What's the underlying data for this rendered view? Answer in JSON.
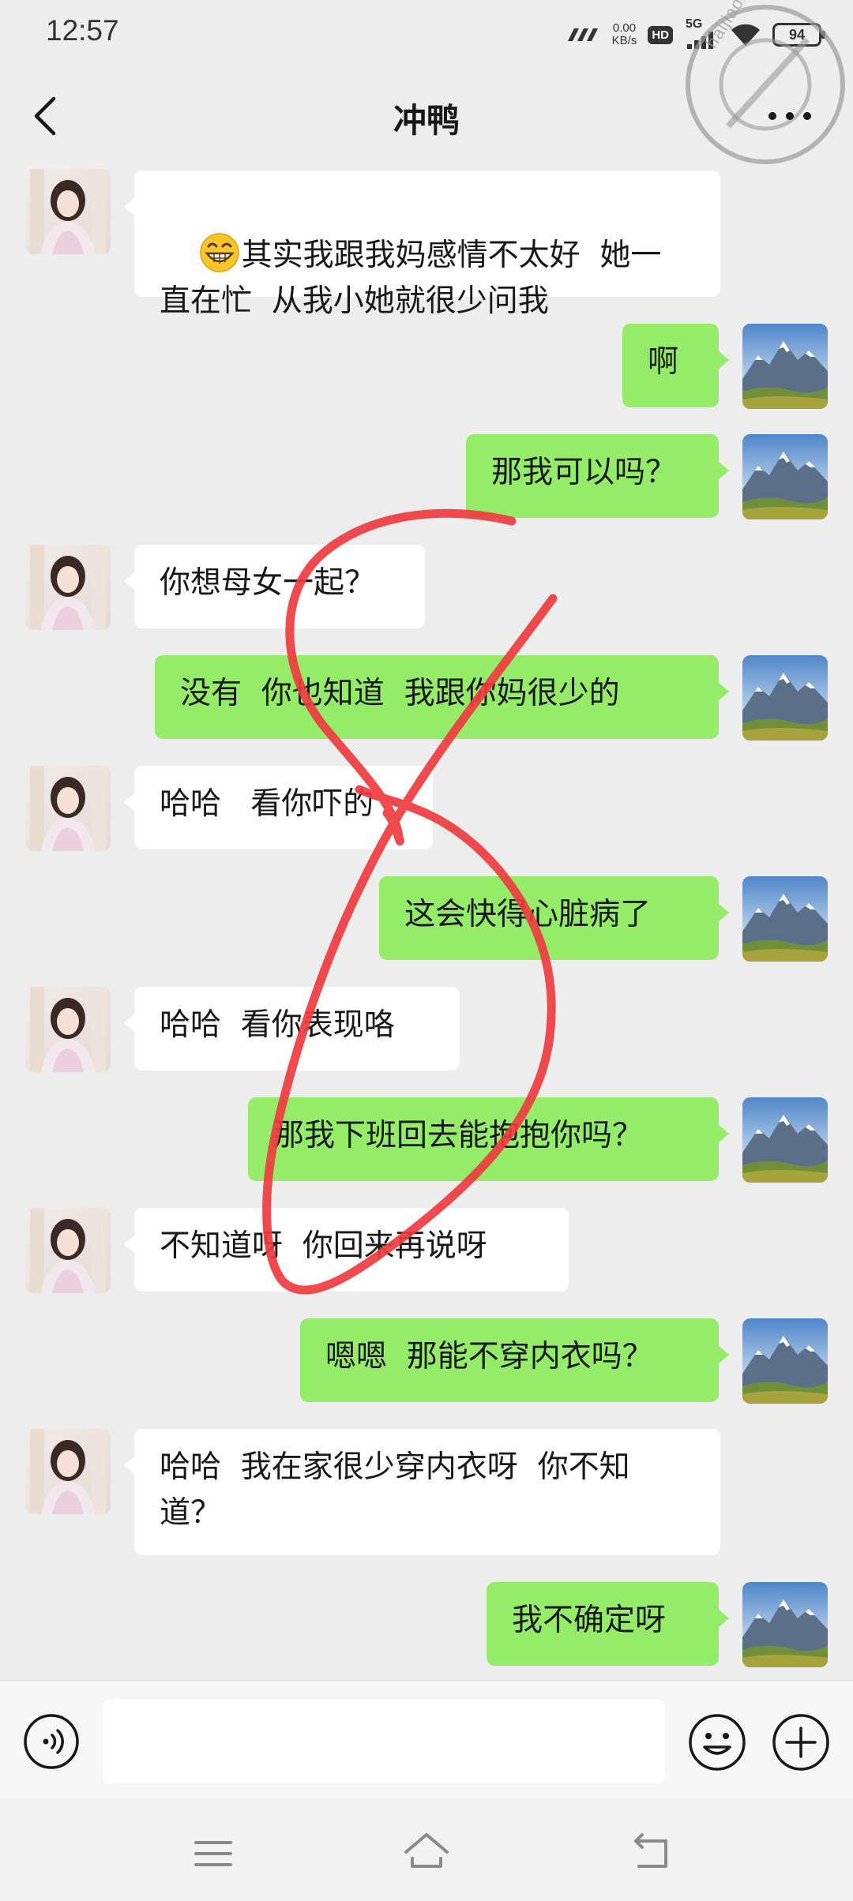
{
  "status_bar": {
    "time": "12:57",
    "net_speed_value": "0.00",
    "net_speed_unit": "KB/s",
    "hd_label": "HD",
    "network_label": "5G",
    "battery": "94"
  },
  "watermark": {
    "text": "haijiao.com"
  },
  "header": {
    "title": "冲鸭"
  },
  "messages": [
    {
      "from": "other",
      "text": "其实我跟我妈感情不太好  她一\n直在忙  从我小她就很少问我",
      "emoji": "grin-icon"
    },
    {
      "from": "me",
      "text": "啊"
    },
    {
      "from": "me",
      "text": "那我可以吗？"
    },
    {
      "from": "other",
      "text": "你想母女一起？"
    },
    {
      "from": "me",
      "text": "没有  你也知道  我跟你妈很少的"
    },
    {
      "from": "other",
      "text": "哈哈   看你吓的"
    },
    {
      "from": "me",
      "text": "这会快得心脏病了"
    },
    {
      "from": "other",
      "text": "哈哈  看你表现咯"
    },
    {
      "from": "me",
      "text": "那我下班回去能抱抱你吗？"
    },
    {
      "from": "other",
      "text": "不知道呀  你回来再说呀"
    },
    {
      "from": "me",
      "text": "嗯嗯  那能不穿内衣吗？"
    },
    {
      "from": "other",
      "text": "哈哈  我在家很少穿内衣呀  你不知\n道？"
    },
    {
      "from": "me",
      "text": "我不确定呀"
    }
  ],
  "input": {
    "value": "",
    "placeholder": ""
  },
  "colors": {
    "background": "#ededed",
    "incoming_bubble": "#ffffff",
    "outgoing_bubble": "#95ec69",
    "scribble": "#ef3b3f"
  }
}
